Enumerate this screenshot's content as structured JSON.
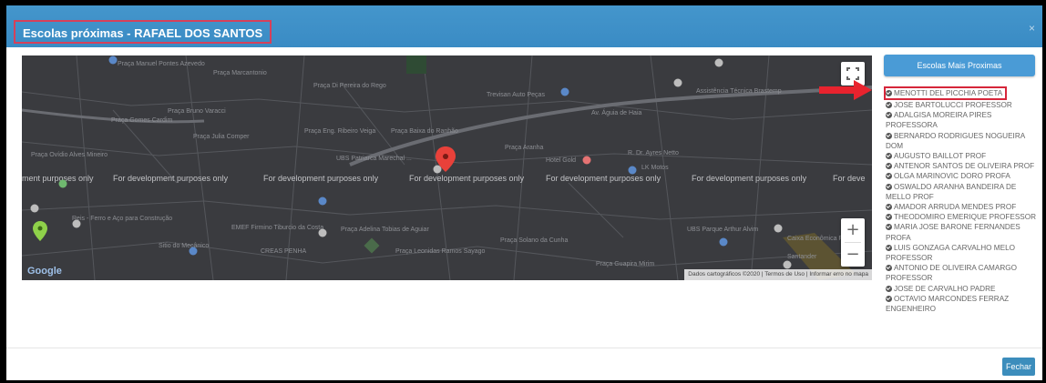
{
  "modal": {
    "title": "Escolas próximas - RAFAEL DOS SANTOS",
    "close": "×"
  },
  "map": {
    "dev_watermark": "For development purposes only",
    "dev_watermark_left": "ment purposes only",
    "dev_watermark_right": "For deve",
    "google_logo": "Google",
    "attribution": "Dados cartográficos ©2020 | Termos de Uso | Informar erro no mapa",
    "zoom_in": "+",
    "zoom_out": "−",
    "labels": {
      "praca_manuel": "Praça Manuel Pontes Azevedo",
      "praca_marcantonio": "Praça Marcantonio",
      "praca_di_pereira": "Praça Di Pereira do Rego",
      "praca_gomes_cardim": "Praça Gomes Cardim",
      "praca_bruno_varacci": "Praça Bruno Varacci",
      "praca_julia_comper": "Praça Julia Comper",
      "praca_eng_ribeiro": "Praça Eng. Ribeiro Veiga",
      "praca_baixa": "Praça Baixa do Ranhão",
      "praca_aranha": "Praça Aranha",
      "praca_ovidio": "Praça Ovídio Alves Mineiro",
      "ubs": "UBS Patriarca Marechal ...",
      "reis_ferro": "Reis - Ferro e Aço para Construção",
      "emef": "EMEF Firmino Tiburcio da Costa",
      "creas": "CREAS PENHA",
      "praca_adelina": "Praça Adelina Tobias de Aguiar",
      "praca_leonidas": "Praça Leonidas Ramos Sayago",
      "praca_solano": "Praça Solano da Cunha",
      "ubs_parque": "UBS Parque Arthur Alvim",
      "caixa": "Caixa Econômica Federal",
      "trevisan": "Trevisan Auto Peças",
      "assistencia": "Assistência Técnica Brastemp",
      "hotel": "Hotel Gold",
      "lk_motos": "LK Motos",
      "santander": "Santander",
      "sitio_do_mecanico": "Sitio do Mecânico",
      "praca_guapira": "Praça Guapira Mirim",
      "av_aguia": "Av. Águia de Haia",
      "r_dr_ayres": "R. Dr. Ayres Netto"
    }
  },
  "sidebar": {
    "button_label": "Escolas Mais Proximas",
    "schools": [
      "MENOTTI DEL PICCHIA POETA",
      "JOSE BARTOLUCCI PROFESSOR",
      "ADALGISA MOREIRA PIRES PROFESSORA",
      "BERNARDO RODRIGUES NOGUEIRA DOM",
      "AUGUSTO BAILLOT PROF",
      "ANTENOR SANTOS DE OLIVEIRA PROF",
      "OLGA MARINOVIC DORO PROFA",
      "OSWALDO ARANHA BANDEIRA DE MELLO PROF",
      "AMADOR ARRUDA MENDES PROF",
      "THEODOMIRO EMERIQUE PROFESSOR",
      "MARIA JOSE BARONE FERNANDES PROFA",
      "LUIS GONZAGA CARVALHO MELO PROFESSOR",
      "ANTONIO DE OLIVEIRA CAMARGO PROFESSOR",
      "JOSE DE CARVALHO PADRE",
      "OCTAVIO MARCONDES FERRAZ ENGENHEIRO"
    ]
  },
  "footer": {
    "close_button": "Fechar"
  },
  "colors": {
    "header": "#3c8dbc",
    "highlight": "#d6263a",
    "map_bg": "#3a3b3f"
  }
}
